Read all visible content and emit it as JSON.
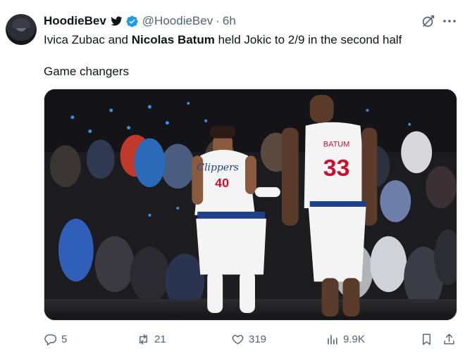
{
  "author": {
    "name": "HoodieBev",
    "handle": "@HoodieBev",
    "separator": "·",
    "time": "6h"
  },
  "tweet": {
    "line1_part1": "Ivica Zubac and ",
    "line1_bold": "Nicolas Batum",
    "line1_part2": " held Jokic to 2/9 in the second half",
    "line2": "Game changers"
  },
  "media": {
    "left_jersey_team": "Clippers",
    "left_jersey_number": "40",
    "right_jersey_name": "BATUM",
    "right_jersey_number": "33"
  },
  "actions": {
    "replies": "5",
    "reposts": "21",
    "likes": "319",
    "views": "9.9K"
  },
  "colors": {
    "text": "#0f1419",
    "secondary": "#536471",
    "verified": "#1d9bf0",
    "jersey_red": "#c8102e",
    "jersey_navy": "#1d428a"
  },
  "icons": [
    "avatar",
    "twitter-bird-icon",
    "verified-icon",
    "grok-icon",
    "more-icon",
    "reply-icon",
    "repost-icon",
    "like-icon",
    "views-icon",
    "bookmark-icon",
    "share-icon"
  ]
}
